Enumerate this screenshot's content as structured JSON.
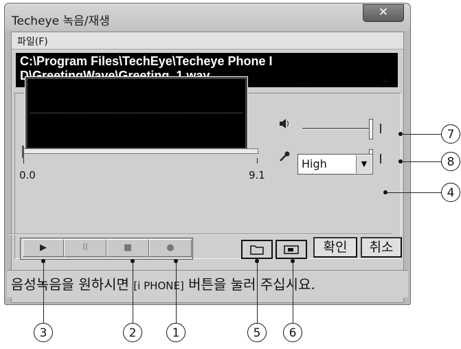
{
  "window": {
    "title": "Techeye 녹음/재생",
    "close": "✕"
  },
  "menu": {
    "file": "파일(F)"
  },
  "path": {
    "line1": "C:\\Program Files\\TechEye\\Techeye Phone I",
    "line2": "D\\GreetingWave\\Greeting_1.wav"
  },
  "sliders": {
    "minus": "--",
    "plus": "+"
  },
  "timeline": {
    "start": "0.0",
    "end": "9.1",
    "position": 0
  },
  "quality": {
    "selected": "High"
  },
  "transport": {
    "play": "▶",
    "pause": "II",
    "stop": "■",
    "record": "●"
  },
  "file_buttons": {
    "open": "📂",
    "save": "💾"
  },
  "dialog_buttons": {
    "ok": "확인",
    "cancel": "취소"
  },
  "status": {
    "part1": "음성녹음을 원하시면 ",
    "part2": "[i PHONE]",
    "part3": " 버튼을 눌러 주십시요."
  },
  "callouts": {
    "n1": "1",
    "n2": "2",
    "n3": "3",
    "n4": "4",
    "n5": "5",
    "n6": "6",
    "n7": "7",
    "n8": "8"
  },
  "icons": {
    "speaker": "speaker-icon",
    "microphone": "microphone-icon"
  }
}
